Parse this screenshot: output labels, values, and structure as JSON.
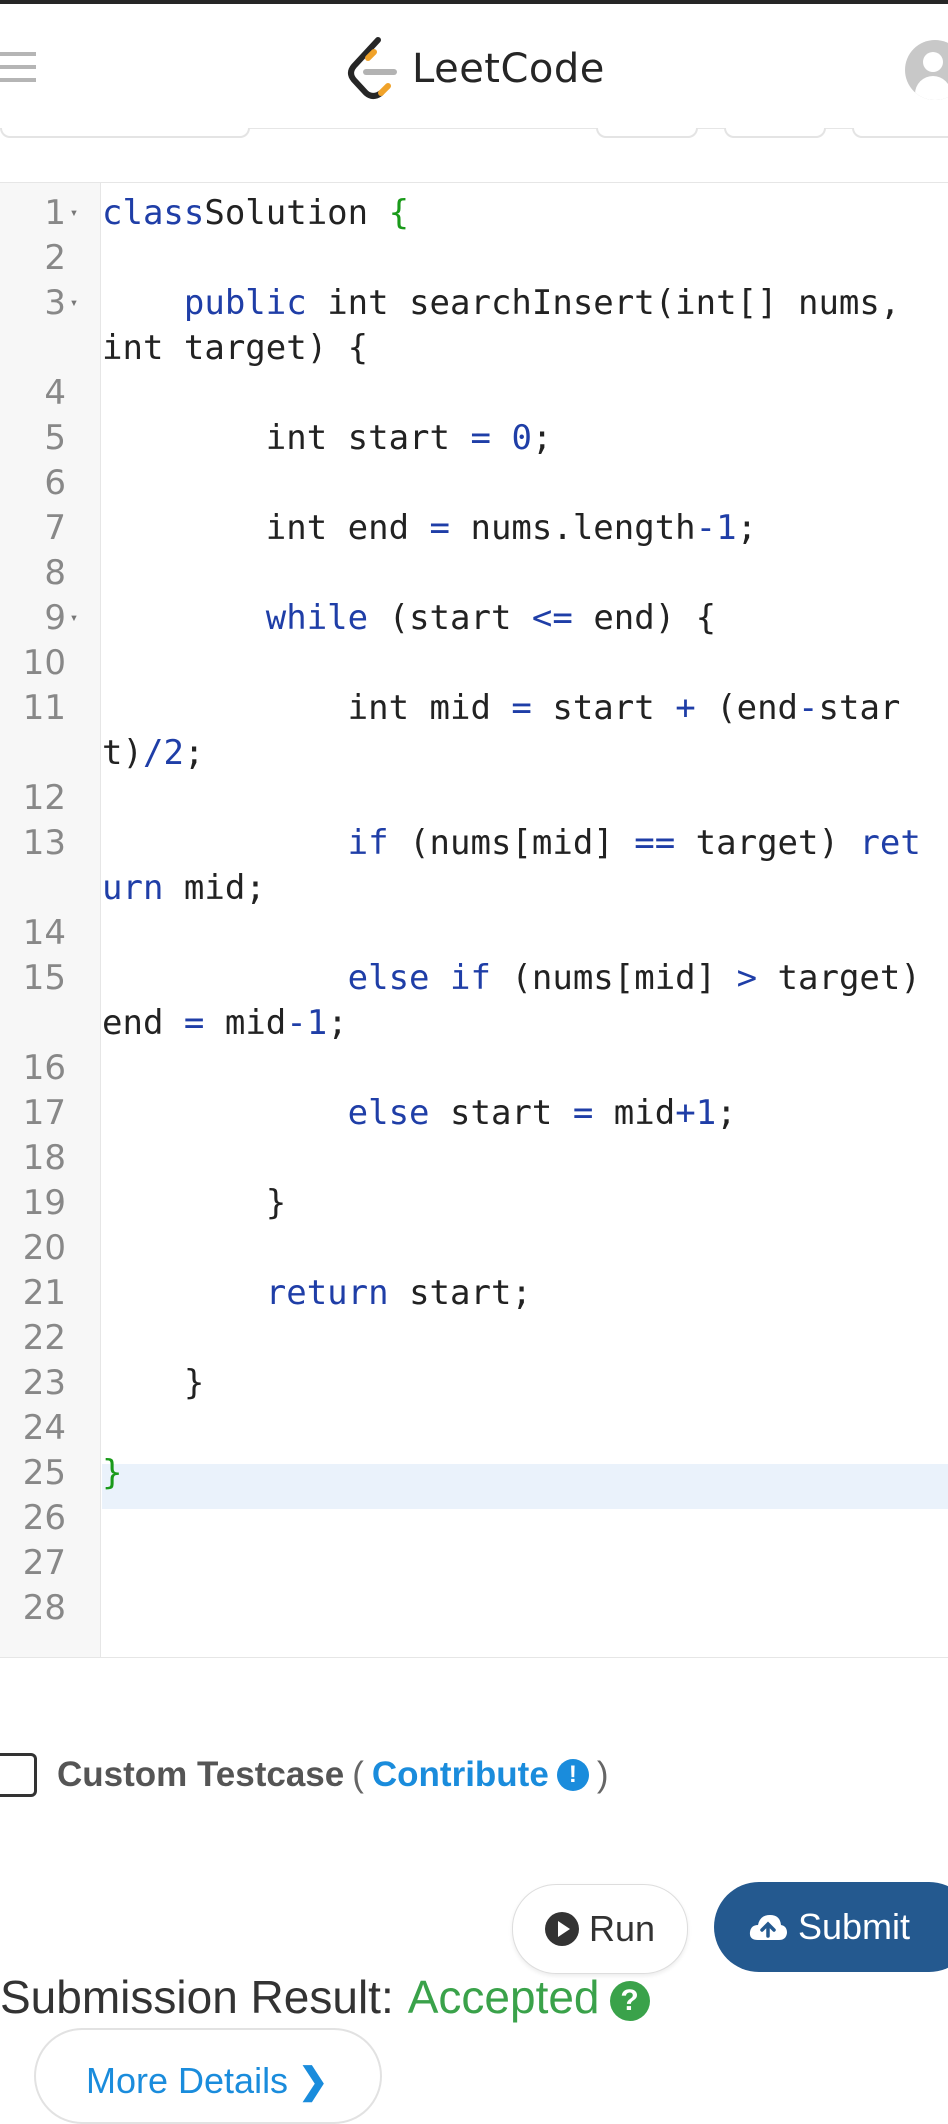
{
  "header": {
    "logo_text": "LeetCode",
    "menu_icon": "hamburger-icon",
    "avatar_icon": "user-avatar-icon"
  },
  "editor": {
    "lines": [
      {
        "n": "1",
        "fold": true
      },
      {
        "n": "2"
      },
      {
        "n": "3",
        "fold": true
      },
      {
        "n": "4"
      },
      {
        "n": "5"
      },
      {
        "n": "6"
      },
      {
        "n": "7"
      },
      {
        "n": "8"
      },
      {
        "n": "9",
        "fold": true
      },
      {
        "n": "10"
      },
      {
        "n": "11"
      },
      {
        "n": "12"
      },
      {
        "n": "13"
      },
      {
        "n": "14"
      },
      {
        "n": "15"
      },
      {
        "n": "16"
      },
      {
        "n": "17"
      },
      {
        "n": "18"
      },
      {
        "n": "19"
      },
      {
        "n": "20"
      },
      {
        "n": "21"
      },
      {
        "n": "22"
      },
      {
        "n": "23"
      },
      {
        "n": "24"
      },
      {
        "n": "25"
      },
      {
        "n": "26"
      },
      {
        "n": "27"
      },
      {
        "n": "28"
      }
    ],
    "code": [
      [
        [
          "kw",
          "class"
        ],
        [
          "",
          "Solution "
        ],
        [
          "br",
          "{"
        ]
      ],
      [],
      [
        [
          "",
          "    "
        ],
        [
          "kw",
          "public"
        ],
        [
          "",
          " int searchInsert(int[] nums, int target) {"
        ]
      ],
      [],
      [
        [
          "",
          "        int start "
        ],
        [
          "op",
          "="
        ],
        [
          "",
          " "
        ],
        [
          "num",
          "0"
        ],
        [
          "",
          ";"
        ]
      ],
      [],
      [
        [
          "",
          "        int end "
        ],
        [
          "op",
          "="
        ],
        [
          "",
          " nums.length"
        ],
        [
          "op",
          "-"
        ],
        [
          "num",
          "1"
        ],
        [
          "",
          ";"
        ]
      ],
      [],
      [
        [
          "",
          "        "
        ],
        [
          "kw",
          "while"
        ],
        [
          "",
          " (start "
        ],
        [
          "op",
          "<="
        ],
        [
          "",
          " end) {"
        ]
      ],
      [],
      [
        [
          "",
          "            int mid "
        ],
        [
          "op",
          "="
        ],
        [
          "",
          " start "
        ],
        [
          "op",
          "+"
        ],
        [
          "",
          " (end"
        ],
        [
          "op",
          "-"
        ],
        [
          "",
          "start)"
        ],
        [
          "op",
          "/"
        ],
        [
          "num",
          "2"
        ],
        [
          "",
          ";"
        ]
      ],
      [],
      [
        [
          "",
          "            "
        ],
        [
          "kw",
          "if"
        ],
        [
          "",
          " (nums[mid] "
        ],
        [
          "op",
          "=="
        ],
        [
          "",
          " target) "
        ],
        [
          "kw",
          "return"
        ],
        [
          "",
          " mid;"
        ]
      ],
      [],
      [
        [
          "",
          "            "
        ],
        [
          "kw",
          "else if"
        ],
        [
          "",
          " (nums[mid] "
        ],
        [
          "op",
          ">"
        ],
        [
          "",
          " target) end "
        ],
        [
          "op",
          "="
        ],
        [
          "",
          " mid"
        ],
        [
          "op",
          "-"
        ],
        [
          "num",
          "1"
        ],
        [
          "",
          ";"
        ]
      ],
      [],
      [
        [
          "",
          "            "
        ],
        [
          "kw",
          "else"
        ],
        [
          "",
          " start "
        ],
        [
          "op",
          "="
        ],
        [
          "",
          " mid"
        ],
        [
          "op",
          "+"
        ],
        [
          "num",
          "1"
        ],
        [
          "",
          ";"
        ]
      ],
      [],
      [
        [
          "",
          "        }"
        ]
      ],
      [],
      [
        [
          "",
          "        "
        ],
        [
          "kw",
          "return"
        ],
        [
          "",
          " start;"
        ]
      ],
      [],
      [
        [
          "",
          "    }"
        ]
      ],
      [],
      [
        [
          "br",
          "}"
        ]
      ],
      [],
      [],
      []
    ]
  },
  "testcase": {
    "label": "Custom Testcase",
    "open_paren": "(",
    "contribute": "Contribute",
    "info_icon": "!",
    "close_paren": ")"
  },
  "actions": {
    "run_label": "Run",
    "submit_label": "Submit"
  },
  "result": {
    "label": "Submission Result:",
    "status": "Accepted",
    "status_color": "#3aa24a",
    "help_icon": "?",
    "more_details": "More Details"
  },
  "colors": {
    "submit_bg": "#24598f",
    "link": "#1a8cdc",
    "keyword": "#1f3ea7",
    "brace": "#1a9a1a"
  }
}
